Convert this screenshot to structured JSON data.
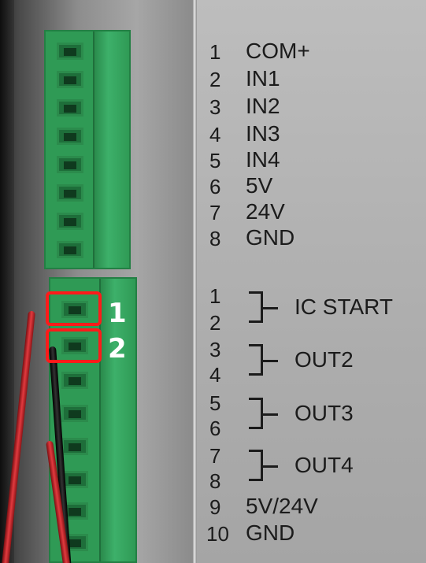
{
  "input_terminals": [
    {
      "pin": "1",
      "label": "COM+"
    },
    {
      "pin": "2",
      "label": "IN1"
    },
    {
      "pin": "3",
      "label": "IN2"
    },
    {
      "pin": "4",
      "label": "IN3"
    },
    {
      "pin": "5",
      "label": "IN4"
    },
    {
      "pin": "6",
      "label": "5V"
    },
    {
      "pin": "7",
      "label": "24V"
    },
    {
      "pin": "8",
      "label": "GND"
    }
  ],
  "output_terminals": {
    "pins": [
      "1",
      "2",
      "3",
      "4",
      "5",
      "6",
      "7",
      "8"
    ],
    "groups": [
      "IC START",
      "OUT2",
      "OUT3",
      "OUT4"
    ],
    "extra": [
      {
        "pin": "9",
        "label": "5V/24V"
      },
      {
        "pin": "10",
        "label": "GND"
      }
    ]
  },
  "callouts": [
    "1",
    "2"
  ],
  "colors": {
    "terminal_green": "#2f9a55",
    "callout_red": "#ff1a1a",
    "wire_red": "#e23a3f",
    "wire_black": "#111111",
    "panel_gray": "#b5b5b5"
  }
}
